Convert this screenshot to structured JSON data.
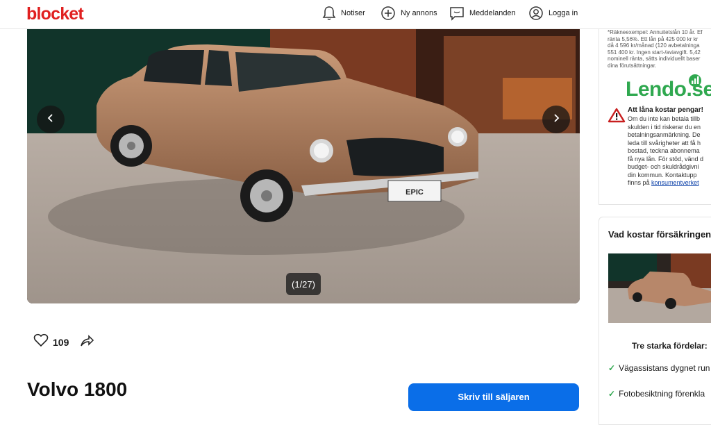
{
  "header": {
    "logo": "blocket",
    "nav": [
      {
        "label": "Notiser",
        "icon": "bell-icon"
      },
      {
        "label": "Ny annons",
        "icon": "plus-circle-icon"
      },
      {
        "label": "Meddelanden",
        "icon": "chat-icon"
      },
      {
        "label": "Logga in",
        "icon": "user-icon"
      }
    ]
  },
  "gallery": {
    "counter": "(1/27)",
    "plate_text": "EPIC"
  },
  "listing": {
    "likes": "109",
    "title": "Volvo 1800",
    "contact_button": "Skriv till säljaren"
  },
  "ad": {
    "fine_print": "*Räkneexempel: Annuitetslån 10 år. Ef\nränta 5,56%. Ett lån på 425 000 kr kr\ndå 4 596 kr/månad (120 avbetalninga\n551 400 kr. Ingen start-/aviavgift. 5,42\nnominell ränta, sätts individuellt baser\ndina förutsättningar.",
    "brand": "Lendo.se",
    "warning_title": "Att låna kostar pengar!",
    "warning_text": "Om du inte kan betala tillb\nskulden i tid riskerar du en\nbetalningsanmärkning. De\nleda till svårigheter att få h\nbostad, teckna abonnema\nfå nya lån. För stöd, vänd d\nbudget- och skuldrådgivni\ndin kommun. Kontaktupp\nfinns på",
    "warning_link": "konsumentverket"
  },
  "insurance": {
    "title": "Vad kostar försäkringen",
    "subtitle": "Tre starka fördelar:",
    "features": [
      "Vägassistans dygnet run",
      "Fotobesiktning förenkla"
    ]
  },
  "colors": {
    "brand_red": "#e02020",
    "primary_blue": "#0a6ee8",
    "lendo_green": "#2fa84f"
  }
}
